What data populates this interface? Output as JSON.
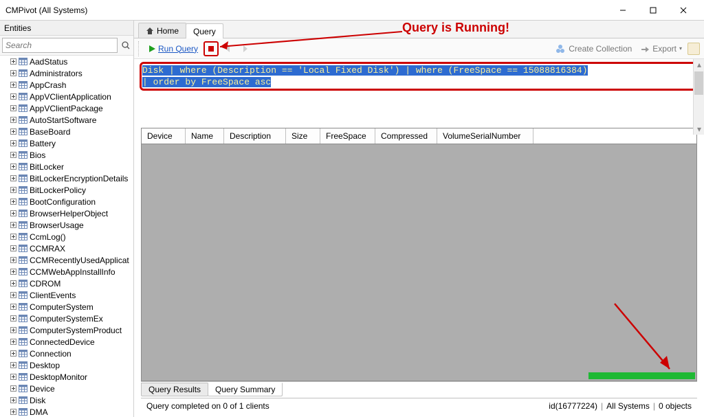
{
  "window": {
    "title": "CMPivot (All Systems)"
  },
  "left": {
    "panel_title": "Entities",
    "search_placeholder": "Search",
    "items": [
      "AadStatus",
      "Administrators",
      "AppCrash",
      "AppVClientApplication",
      "AppVClientPackage",
      "AutoStartSoftware",
      "BaseBoard",
      "Battery",
      "Bios",
      "BitLocker",
      "BitLockerEncryptionDetails",
      "BitLockerPolicy",
      "BootConfiguration",
      "BrowserHelperObject",
      "BrowserUsage",
      "CcmLog()",
      "CCMRAX",
      "CCMRecentlyUsedApplicat",
      "CCMWebAppInstallInfo",
      "CDROM",
      "ClientEvents",
      "ComputerSystem",
      "ComputerSystemEx",
      "ComputerSystemProduct",
      "ConnectedDevice",
      "Connection",
      "Desktop",
      "DesktopMonitor",
      "Device",
      "Disk",
      "DMA"
    ]
  },
  "tabs": {
    "home": "Home",
    "query": "Query"
  },
  "toolbar": {
    "run": "Run Query",
    "create_collection": "Create Collection",
    "export": "Export"
  },
  "query": {
    "line1": "Disk | where (Description == 'Local Fixed Disk') | where (FreeSpace == 15088816384)",
    "line2": "| order by FreeSpace asc"
  },
  "grid": {
    "columns": [
      "Device",
      "Name",
      "Description",
      "Size",
      "FreeSpace",
      "Compressed",
      "VolumeSerialNumber"
    ]
  },
  "bottom_tabs": {
    "results": "Query Results",
    "summary": "Query Summary"
  },
  "status": {
    "text": "Query completed on 0 of 1 clients",
    "id": "id(16777224)",
    "scope": "All Systems",
    "objects": "0 objects"
  },
  "annotation": {
    "running": "Query is Running!"
  }
}
